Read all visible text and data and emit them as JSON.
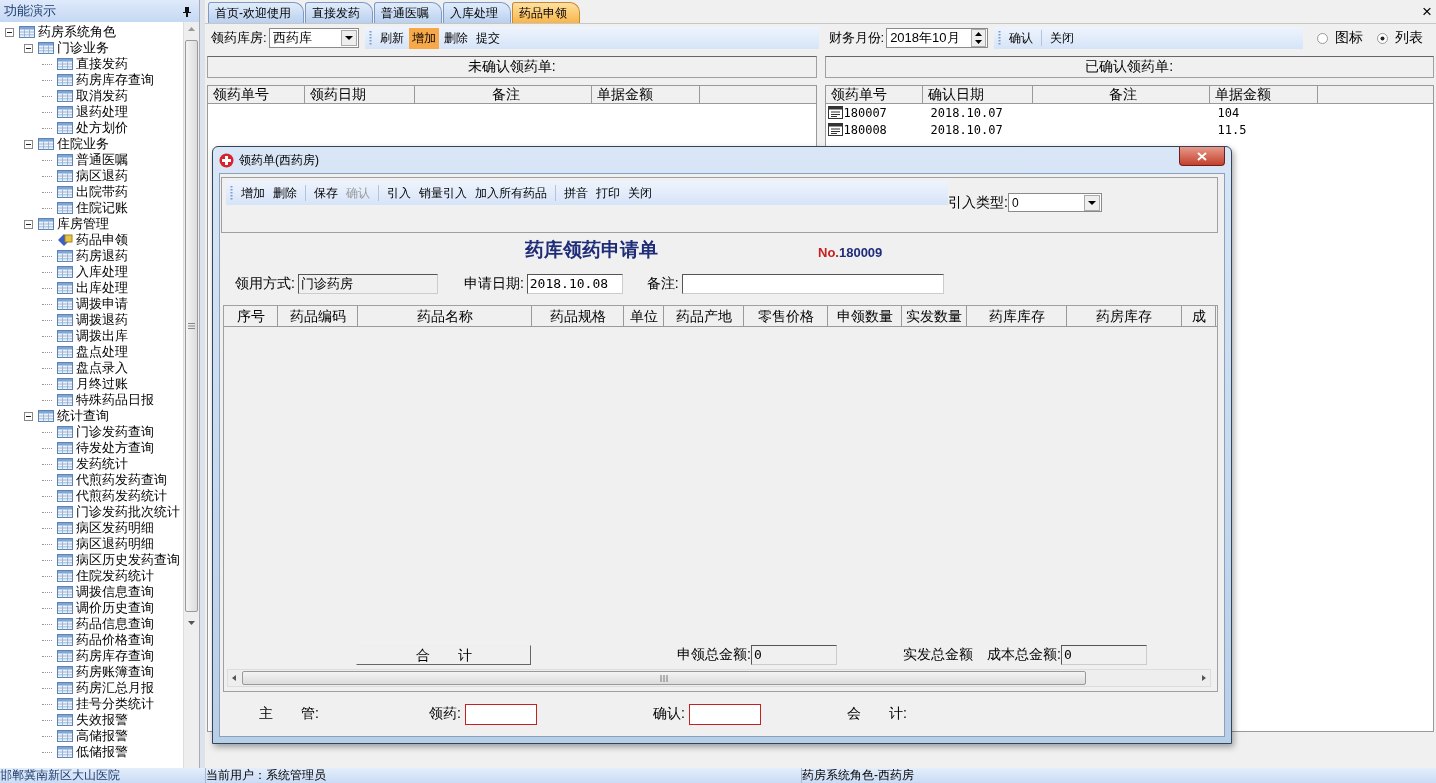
{
  "sidebar": {
    "title": "功能演示",
    "items": [
      {
        "label": "药房系统角色",
        "expanded": true,
        "children": [
          {
            "label": "门诊业务",
            "expanded": true,
            "children": [
              {
                "label": "直接发药",
                "selected": false
              },
              {
                "label": "药房库存查询",
                "selected": false
              },
              {
                "label": "取消发药",
                "selected": false
              },
              {
                "label": "退药处理",
                "selected": false
              },
              {
                "label": "处方划价",
                "selected": false
              }
            ]
          },
          {
            "label": "住院业务",
            "expanded": true,
            "children": [
              {
                "label": "普通医嘱",
                "selected": false
              },
              {
                "label": "病区退药",
                "selected": false
              },
              {
                "label": "出院带药",
                "selected": false
              },
              {
                "label": "住院记账",
                "selected": false
              }
            ]
          },
          {
            "label": "库房管理",
            "expanded": true,
            "children": [
              {
                "label": "药品申领",
                "selected": true
              },
              {
                "label": "药房退药",
                "selected": false
              },
              {
                "label": "入库处理",
                "selected": false
              },
              {
                "label": "出库处理",
                "selected": false
              },
              {
                "label": "调拨申请",
                "selected": false
              },
              {
                "label": "调拨退药",
                "selected": false
              },
              {
                "label": "调拨出库",
                "selected": false
              },
              {
                "label": "盘点处理",
                "selected": false
              },
              {
                "label": "盘点录入",
                "selected": false
              },
              {
                "label": "月终过账",
                "selected": false
              },
              {
                "label": "特殊药品日报",
                "selected": false
              }
            ]
          },
          {
            "label": "统计查询",
            "expanded": true,
            "children": [
              {
                "label": "门诊发药查询",
                "selected": false
              },
              {
                "label": "待发处方查询",
                "selected": false
              },
              {
                "label": "发药统计",
                "selected": false
              },
              {
                "label": "代煎药发药查询",
                "selected": false
              },
              {
                "label": "代煎药发药统计",
                "selected": false
              },
              {
                "label": "门诊发药批次统计",
                "selected": false
              },
              {
                "label": "病区发药明细",
                "selected": false
              },
              {
                "label": "病区退药明细",
                "selected": false
              },
              {
                "label": "病区历史发药查询",
                "selected": false
              },
              {
                "label": "住院发药统计",
                "selected": false
              },
              {
                "label": "调拨信息查询",
                "selected": false
              },
              {
                "label": "调价历史查询",
                "selected": false
              },
              {
                "label": "药品信息查询",
                "selected": false
              },
              {
                "label": "药品价格查询",
                "selected": false
              },
              {
                "label": "药房库存查询",
                "selected": false
              },
              {
                "label": "药房账簿查询",
                "selected": false
              },
              {
                "label": "药房汇总月报",
                "selected": false
              },
              {
                "label": "挂号分类统计",
                "selected": false
              },
              {
                "label": "失效报警",
                "selected": false
              },
              {
                "label": "高储报警",
                "selected": false
              },
              {
                "label": "低储报警",
                "selected": false
              }
            ]
          }
        ]
      }
    ]
  },
  "tabs": [
    {
      "label": "首页-欢迎使用",
      "selected": false
    },
    {
      "label": "直接发药",
      "selected": false
    },
    {
      "label": "普通医嘱",
      "selected": false
    },
    {
      "label": "入库处理",
      "selected": false
    },
    {
      "label": "药品申领",
      "selected": true
    }
  ],
  "close_symbol": "×",
  "left_panel": {
    "warehouse_label": "领药库房:",
    "warehouse_value": "西药库",
    "toolbar": [
      {
        "label": "刷新",
        "highlighted": false
      },
      {
        "label": "增加",
        "highlighted": true
      },
      {
        "label": "删除",
        "highlighted": false
      },
      {
        "label": "提交",
        "highlighted": false
      }
    ],
    "title": "未确认领药单:",
    "columns": [
      "领药单号",
      "领药日期",
      "备注",
      "单据金额"
    ]
  },
  "right_panel": {
    "month_label": "财务月份:",
    "month_value": "2018年10月",
    "toolbar": [
      {
        "label": "确认",
        "highlighted": false
      },
      {
        "label": "关闭",
        "highlighted": false
      }
    ],
    "view_options": [
      {
        "label": "图标",
        "selected": false
      },
      {
        "label": "列表",
        "selected": true
      }
    ],
    "title": "已确认领药单:",
    "columns": [
      "领药单号",
      "确认日期",
      "备注",
      "单据金额"
    ],
    "rows": [
      {
        "number": "180007",
        "date": "2018.10.07",
        "amount": "104"
      },
      {
        "number": "180008",
        "date": "2018.10.07",
        "amount": "11.5"
      }
    ]
  },
  "dialog": {
    "title": "领药单(西药房)",
    "toolbar_groups": [
      {
        "items": [
          {
            "label": "增加",
            "disabled": false
          },
          {
            "label": "删除",
            "disabled": false
          }
        ]
      },
      {
        "items": [
          {
            "label": "保存",
            "disabled": false
          },
          {
            "label": "确认",
            "disabled": true
          }
        ]
      },
      {
        "items": [
          {
            "label": "引入",
            "disabled": false
          },
          {
            "label": "销量引入",
            "disabled": false
          },
          {
            "label": "加入所有药品",
            "disabled": false
          }
        ]
      },
      {
        "items": [
          {
            "label": "拼音",
            "disabled": false
          },
          {
            "label": "打印",
            "disabled": false
          },
          {
            "label": "关闭",
            "disabled": false
          }
        ]
      }
    ],
    "import_type_label": "引入类型:",
    "import_type_value": "0",
    "heading": "药库领药申请单",
    "number_prefix": "No.",
    "number": "180009",
    "usage_label": "领用方式:",
    "usage_value": "门诊药房",
    "date_label": "申请日期:",
    "date_value": "2018.10.08",
    "note_label": "备注:",
    "columns": [
      "序号",
      "药品编码",
      "药品名称",
      "药品规格",
      "单位",
      "药品产地",
      "零售价格",
      "申领数量",
      "实发数量",
      "药库库存",
      "药房库存",
      "成"
    ],
    "total_button": "合　　计",
    "totals": [
      {
        "label": "申领总金额:",
        "value": "0"
      },
      {
        "label": "实发总金额"
      },
      {
        "label": "成本总金额:",
        "value": "0"
      }
    ],
    "signatures": [
      {
        "label": "主　　管:",
        "kind": "text"
      },
      {
        "label": "领药:",
        "kind": "input"
      },
      {
        "label": "确认:",
        "kind": "input"
      },
      {
        "label": "会　　计:",
        "kind": "text"
      }
    ]
  },
  "status_bar": [
    "邯郸冀南新区大山医院",
    "当前用户：系统管理员",
    "药房系统角色-西药房"
  ]
}
